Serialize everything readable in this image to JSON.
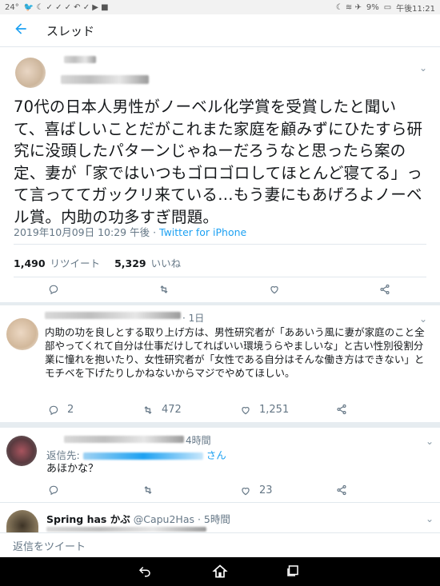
{
  "status_bar": {
    "left_text": "24°",
    "battery": "9%",
    "time": "午後11:21"
  },
  "header": {
    "title": "スレッド"
  },
  "main_tweet": {
    "text": "70代の日本人男性がノーベル化学賞を受賞したと聞いて、喜ばしいことだがこれまた家庭を顧みずにひたすら研究に没頭したパターンじゃねーだろうなと思ったら案の定、妻が「家ではいつもゴロゴロしてほとんど寝てる」って言っててガックリ来ている…もう妻にもあげろよノーベル賞。内助の功多すぎ問題。",
    "timestamp": "2019年10月09日 10:29 午後",
    "separator": " · ",
    "client": "Twitter for iPhone",
    "retweets_count": "1,490",
    "retweets_label": "リツイート",
    "likes_count": "5,329",
    "likes_label": "いいね"
  },
  "replies": [
    {
      "time": "· 1日",
      "text": "内助の功を良しとする取り上げ方は、男性研究者が「ああいう風に妻が家庭のこと全部やってくれて自分は仕事だけしてればいい環境うらやましいな」と古い性別役割分業に憧れを抱いたり、女性研究者が「女性である自分はそんな働き方はできない」とモチベを下げたりしかねないからマジでやめてほしい。",
      "reply_count": "2",
      "retweet_count": "472",
      "like_count": "1,251"
    },
    {
      "time": "4時間",
      "reply_to_label": "返信先:",
      "reply_to_suffix": "さん",
      "text": "あほかな？",
      "reply_count": "",
      "retweet_count": "",
      "like_count": "23"
    },
    {
      "name": "Spring has かぶ",
      "handle": "@Capu2Has",
      "time": "· 5時間"
    }
  ],
  "composer": {
    "placeholder": "返信をツイート"
  },
  "icons": [
    "back-arrow-icon",
    "chevron-down-icon",
    "reply-icon",
    "retweet-icon",
    "like-icon",
    "share-icon",
    "nav-back-icon",
    "nav-home-icon",
    "nav-recents-icon"
  ],
  "colors": {
    "accent": "#1da1f2",
    "muted": "#657786",
    "text": "#14171a"
  }
}
